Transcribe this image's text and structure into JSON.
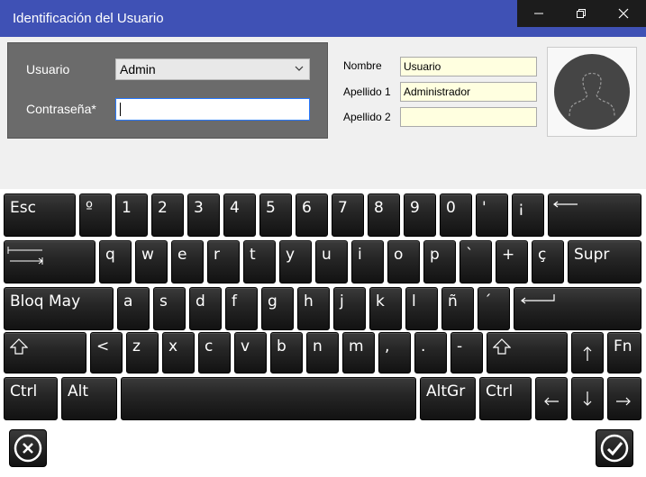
{
  "window": {
    "title": "Identificación del Usuario"
  },
  "login": {
    "user_label": "Usuario",
    "user_value": "Admin",
    "password_label": "Contraseña*",
    "password_value": ""
  },
  "info": {
    "nombre_label": "Nombre",
    "nombre_value": "Usuario",
    "apellido1_label": "Apellido 1",
    "apellido1_value": "Administrador",
    "apellido2_label": "Apellido 2",
    "apellido2_value": ""
  },
  "keyboard": {
    "row1": [
      "Esc",
      "º",
      "1",
      "2",
      "3",
      "4",
      "5",
      "6",
      "7",
      "8",
      "9",
      "0",
      "'",
      "¡"
    ],
    "row2": [
      "q",
      "w",
      "e",
      "r",
      "t",
      "y",
      "u",
      "i",
      "o",
      "p",
      "`",
      "+",
      "ç",
      "Supr"
    ],
    "row3": [
      "Bloq May",
      "a",
      "s",
      "d",
      "f",
      "g",
      "h",
      "j",
      "k",
      "l",
      "ñ",
      "´"
    ],
    "row4": [
      "<",
      "z",
      "x",
      "c",
      "v",
      "b",
      "n",
      "m",
      ",",
      ".",
      "-",
      "Fn"
    ],
    "row5": [
      "Ctrl",
      "Alt",
      "AltGr",
      "Ctrl"
    ]
  },
  "colors": {
    "titlebar": "#3f51b5",
    "key_dark": "#1a1a1a",
    "field_yellow": "#ffffe0"
  },
  "icons": {
    "cancel": "cancel-circle-icon",
    "accept": "check-circle-icon"
  }
}
